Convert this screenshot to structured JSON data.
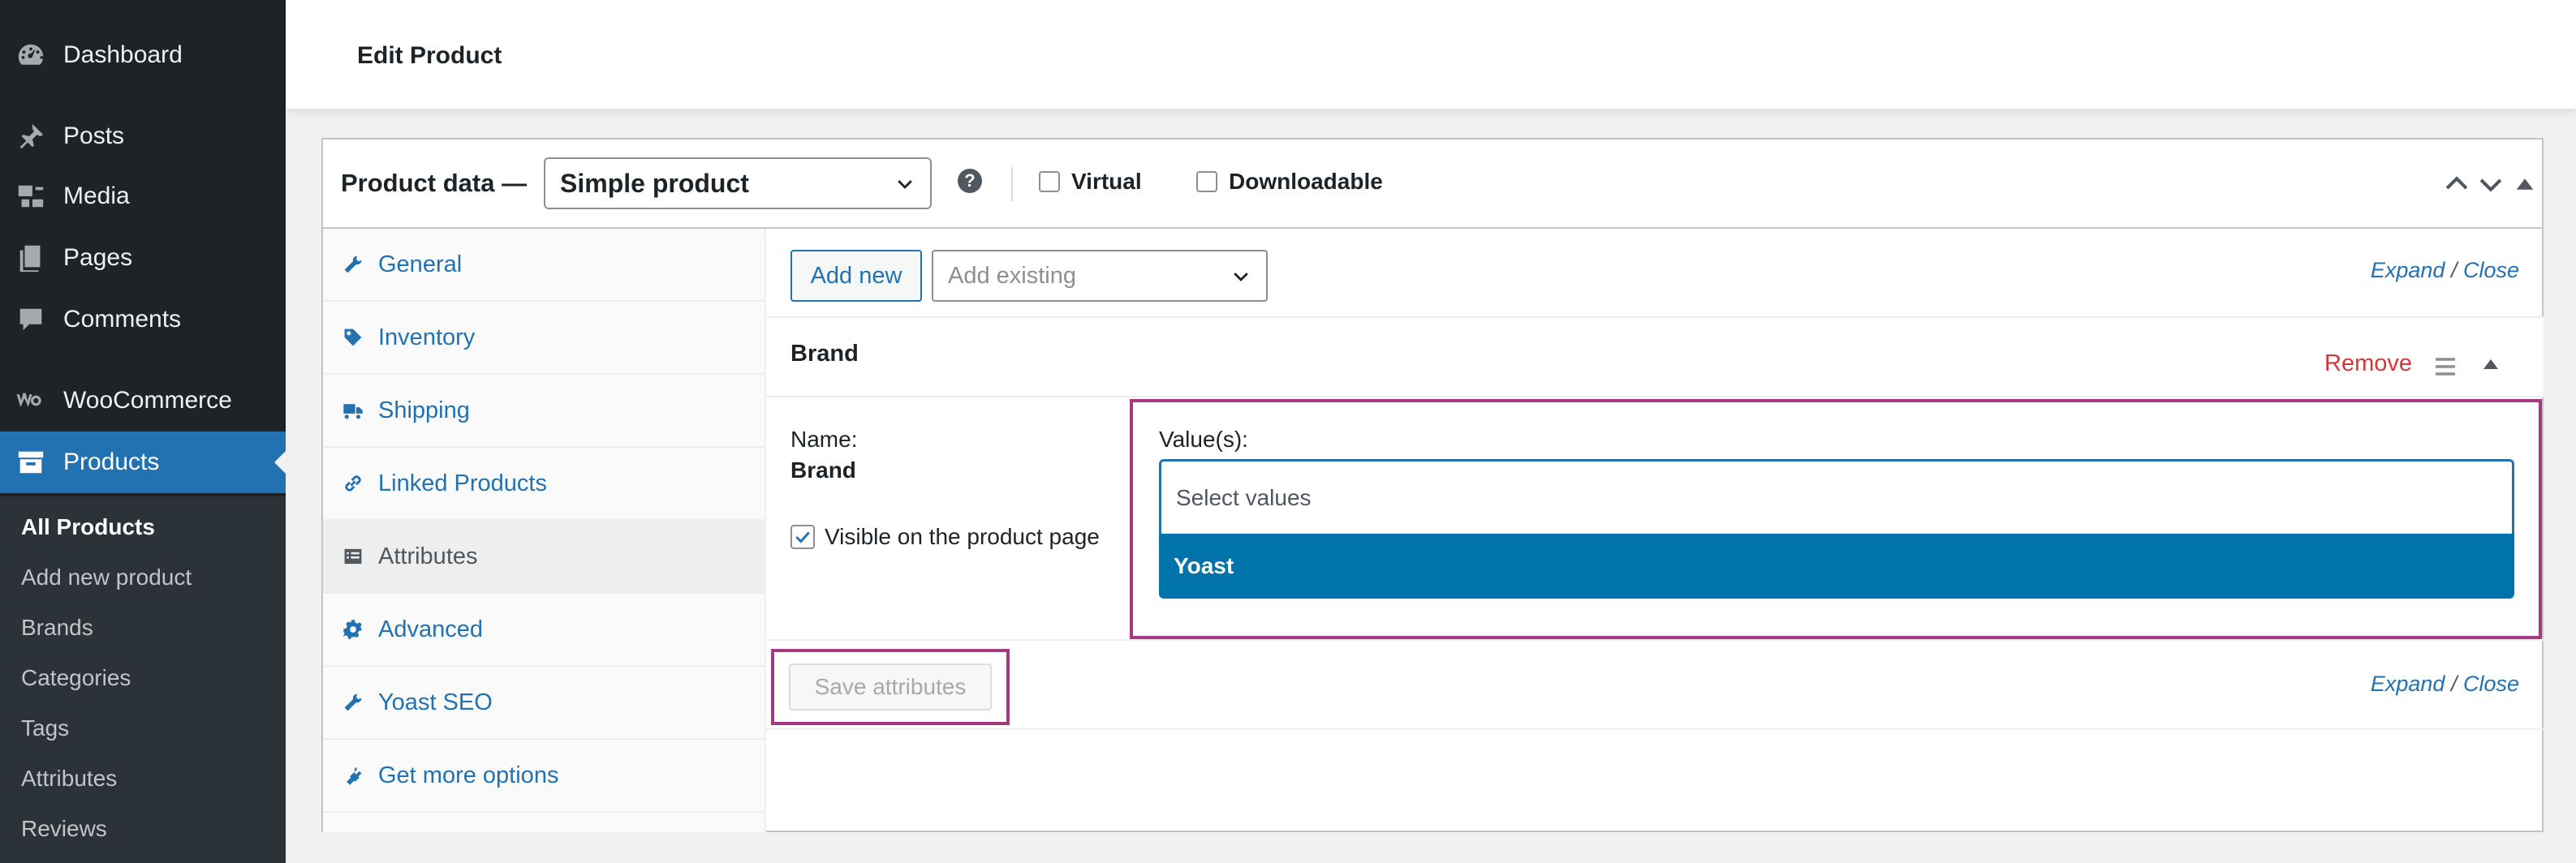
{
  "admin_menu": {
    "items": [
      {
        "label": "Dashboard",
        "icon": "dashboard-icon"
      },
      {
        "label": "Posts",
        "icon": "pin-icon"
      },
      {
        "label": "Media",
        "icon": "media-icon"
      },
      {
        "label": "Pages",
        "icon": "pages-icon"
      },
      {
        "label": "Comments",
        "icon": "comment-icon"
      },
      {
        "label": "WooCommerce",
        "icon": "woocommerce-icon"
      },
      {
        "label": "Products",
        "icon": "archive-icon"
      }
    ],
    "active_item": "Products",
    "submenu": [
      "All Products",
      "Add new product",
      "Brands",
      "Categories",
      "Tags",
      "Attributes",
      "Reviews"
    ],
    "current_submenu": "All Products"
  },
  "header": {
    "title": "Edit Product"
  },
  "product_data": {
    "title": "Product data —",
    "type_value": "Simple product",
    "help_icon": "?",
    "virtual_label": "Virtual",
    "virtual_checked": false,
    "downloadable_label": "Downloadable",
    "downloadable_checked": false
  },
  "tabs": [
    {
      "label": "General",
      "icon": "wrench-icon"
    },
    {
      "label": "Inventory",
      "icon": "tag-icon"
    },
    {
      "label": "Shipping",
      "icon": "truck-icon"
    },
    {
      "label": "Linked Products",
      "icon": "link-icon"
    },
    {
      "label": "Attributes",
      "icon": "list-icon"
    },
    {
      "label": "Advanced",
      "icon": "gear-icon"
    },
    {
      "label": "Yoast SEO",
      "icon": "wrench-icon"
    },
    {
      "label": "Get more options",
      "icon": "plugin-icon"
    }
  ],
  "active_tab": "Attributes",
  "attributes_panel": {
    "add_new_label": "Add new",
    "add_existing_placeholder": "Add existing",
    "expand_label": "Expand",
    "slash": "/",
    "close_label": "Close",
    "attribute": {
      "name": "Brand",
      "remove_label": "Remove",
      "name_label": "Name:",
      "name_value": "Brand",
      "visible_label": "Visible on the product page",
      "visible_checked": true,
      "values_label": "Value(s):",
      "values_placeholder": "Select values",
      "highlighted_option": "Yoast"
    },
    "save_label": "Save attributes"
  },
  "colors": {
    "sidebar_bg": "#1d2327",
    "accent": "#2271b1",
    "option_highlight": "#0073aa",
    "remove": "#d63638",
    "highlight_frame": "#a73981"
  }
}
